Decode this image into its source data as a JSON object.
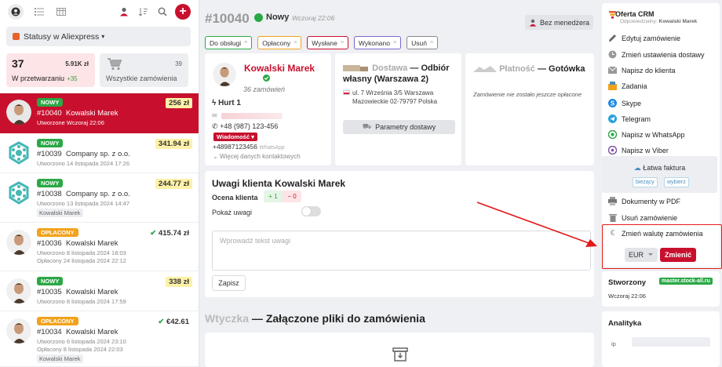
{
  "sidebar": {
    "status_dropdown": "Statusy w Aliexpress",
    "card_active": {
      "count": "37",
      "amount": "5.91K zł",
      "label": "W przetwarzaniu",
      "delta": "+35"
    },
    "card_all": {
      "count": "39",
      "label": "Wszystkie zamówienia"
    },
    "orders": [
      {
        "status": "NOWY",
        "price": "256 zł",
        "number": "#10040",
        "name": "Kowalski Marek",
        "meta1": "Utworzone Wczoraj 22:06",
        "meta2": "",
        "tag": ""
      },
      {
        "status": "NOWY",
        "price": "341.94 zł",
        "number": "#10039",
        "name": "Company sp. z o.o.",
        "meta1": "Utworzono 14 listopada 2024 17:26",
        "meta2": "",
        "tag": ""
      },
      {
        "status": "NOWY",
        "price": "244.77 zł",
        "number": "#10038",
        "name": "Company sp. z o.o.",
        "meta1": "Utworzono 13 listopada 2024 14:47",
        "meta2": "",
        "tag": "Kowalski Marek"
      },
      {
        "status": "OPŁACONY",
        "price": "415.74 zł",
        "number": "#10036",
        "name": "Kowalski Marek",
        "meta1": "Utworzono 8 listopada 2024 18:03",
        "meta2": "Opłacony 24 listopada 2024 22:12",
        "tag": ""
      },
      {
        "status": "NOWY",
        "price": "338 zł",
        "number": "#10035",
        "name": "Kowalski Marek",
        "meta1": "Utworzono 8 listopada 2024 17:59",
        "meta2": "",
        "tag": ""
      },
      {
        "status": "OPŁACONY",
        "price": "€42.61",
        "number": "#10034",
        "name": "Kowalski Marek",
        "meta1": "Utworzono 6 listopada 2024 23:10",
        "meta2": "Opłacony 8 listopada 2024 22:03",
        "tag": "Kowalski Marek"
      }
    ]
  },
  "order": {
    "number": "#10040",
    "status": "Nowy",
    "date": "Wczoraj 22:06",
    "manager_button": "Bez menedżera",
    "chips": [
      "Do obsługi",
      "Opłacony",
      "Wysłane",
      "Wykonano",
      "Usuń"
    ]
  },
  "customer": {
    "name": "Kowalski Marek",
    "orders_count": "36 zamówień",
    "group": "Hurt 1",
    "phone": "+48 (987) 123-456",
    "message_badge": "Wiadomość",
    "whatsapp_number": "+48987123456",
    "whatsapp_label": "WhatsApp",
    "more_contacts": "Więcej danych kontaktowych"
  },
  "delivery": {
    "label": "Dostawa",
    "method": "Odbiór własny (Warszawa 2)",
    "address1": "ul. 7 Września 3/5 Warszawa",
    "address2": "Mazowieckie 02-79797 Polska",
    "button": "Parametry dostawy"
  },
  "payment": {
    "label": "Płatność",
    "method": "Gotówka",
    "note": "Zamówienie nie zostało jeszcze opłacone"
  },
  "notes": {
    "title": "Uwagi klienta Kowalski Marek",
    "rating_label": "Ocena klienta",
    "plus": "+ 1",
    "minus": "− 0",
    "show_label": "Pokaż uwagi",
    "placeholder": "Wprowadź tekst uwagi",
    "save": "Zapisz"
  },
  "plugin": {
    "label": "Wtyczka",
    "title": "Załączone pliki do zamówienia"
  },
  "right": {
    "crm_title": "Oferta CRM",
    "responsible_label": "Odpowiedzialny:",
    "responsible_name": "Kowalski Marek",
    "menu": [
      "Edytuj zamówienie",
      "Zmień ustawienia dostawy",
      "Napisz do klienta",
      "Zadania",
      "Skype",
      "Telegram",
      "Napisz w WhatsApp",
      "Napisz w Viber"
    ],
    "invoice_title": "Łatwa faktura",
    "invoice_current": "bieżący",
    "invoice_choose": "wybierz",
    "docs_pdf": "Dokumenty w PDF",
    "delete_order": "Usuń zamówienie",
    "change_currency": "Zmień walutę zamówienia",
    "currency_value": "EUR",
    "change_button": "Zmienić",
    "created_label": "Stworzony",
    "shop_badge": "master.stock-all.ru",
    "created_date": "Wczoraj 22:06",
    "analytics_title": "Analityka",
    "ip_label": "ip"
  },
  "colors": {
    "accent": "#c8102e",
    "status_new": "#2aa845",
    "status_paid": "#f2a21b",
    "annotation": "#e31818"
  }
}
